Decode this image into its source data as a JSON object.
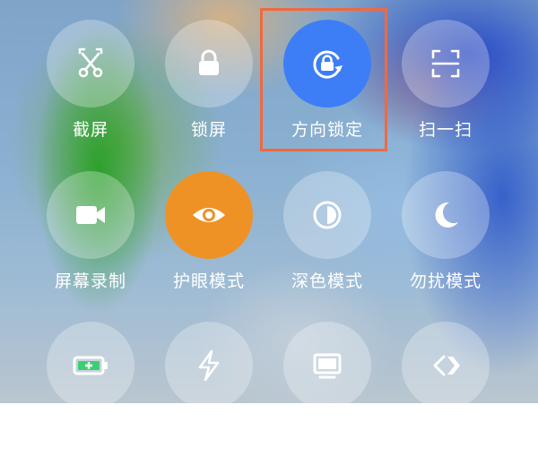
{
  "tiles": [
    {
      "label": "截屏",
      "icon": "screenshot-icon"
    },
    {
      "label": "锁屏",
      "icon": "lock-icon"
    },
    {
      "label": "方向锁定",
      "icon": "rotation-lock-icon",
      "active": true,
      "color": "#3d7ef7"
    },
    {
      "label": "扫一扫",
      "icon": "scan-icon"
    },
    {
      "label": "屏幕录制",
      "icon": "screen-record-icon"
    },
    {
      "label": "护眼模式",
      "icon": "eye-icon",
      "active": true,
      "color": "#ef9225"
    },
    {
      "label": "深色模式",
      "icon": "dark-mode-icon"
    },
    {
      "label": "勿扰模式",
      "icon": "moon-icon"
    },
    {
      "label": "",
      "icon": "battery-saver-icon"
    },
    {
      "label": "",
      "icon": "lightning-icon"
    },
    {
      "label": "",
      "icon": "monitor-icon"
    },
    {
      "label": "",
      "icon": "code-brackets-icon"
    }
  ],
  "highlight_color": "#f0693f"
}
